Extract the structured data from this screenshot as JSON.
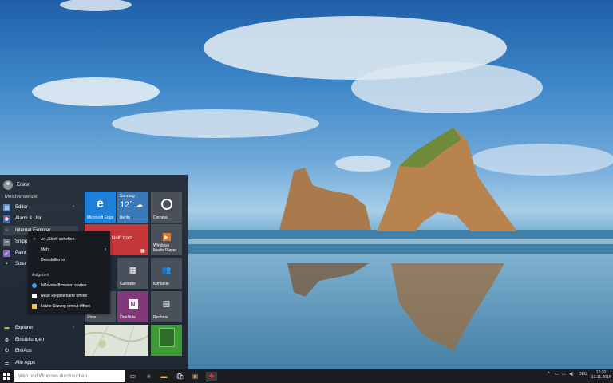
{
  "start_menu": {
    "user_name": "Erster",
    "section_most_used": "Meistverwendet",
    "apps": [
      {
        "label": "Editor",
        "has_submenu": true,
        "icon": "notepad-icon"
      },
      {
        "label": "Alarm & Uhr",
        "has_submenu": false,
        "icon": "alarm-clock-icon"
      },
      {
        "label": "Internet Explorer",
        "has_submenu": false,
        "icon": "internet-explorer-icon"
      },
      {
        "label": "Snipp",
        "has_submenu": false,
        "icon": "snipping-tool-icon"
      },
      {
        "label": "Paint",
        "has_submenu": false,
        "icon": "paint-icon"
      },
      {
        "label": "Sizer",
        "has_submenu": false,
        "icon": "plus-icon"
      }
    ],
    "bottom": [
      {
        "label": "Explorer",
        "has_submenu": true,
        "icon": "folder-icon"
      },
      {
        "label": "Einstellungen",
        "has_submenu": false,
        "icon": "gear-icon"
      },
      {
        "label": "Ein/Aus",
        "has_submenu": false,
        "icon": "power-icon"
      },
      {
        "label": "Alle Apps",
        "has_submenu": false,
        "icon": "list-icon"
      }
    ],
    "tiles": {
      "edge": "Microsoft Edge",
      "weather_day": "Sonntag",
      "weather_temp": "12°",
      "weather_city": "Berlin",
      "cortana": "Cortana",
      "news_text": "Null\" trotz",
      "wmp": "Windows Media Player",
      "calendar": "Kalender",
      "contacts": "Kontakte",
      "xbox_label": "Xbox",
      "onenote": "OneNote",
      "calculator": "Rechner"
    }
  },
  "context_menu": {
    "items": [
      {
        "label": "An „Start\" anheften",
        "icon": "pin-icon"
      },
      {
        "label": "Mehr",
        "icon": "",
        "has_submenu": true
      },
      {
        "label": "Deinstallieren",
        "icon": ""
      }
    ],
    "tasks_header": "Aufgaben",
    "tasks": [
      {
        "label": "InPrivate-Browsen starten",
        "icon": "inprivate-icon"
      },
      {
        "label": "Neue Registerkarte öffnen",
        "icon": "new-tab-icon"
      },
      {
        "label": "Letzte Sitzung erneut öffnen",
        "icon": "folder-icon"
      }
    ]
  },
  "taskbar": {
    "search_placeholder": "Web und Windows durchsuchen",
    "language": "DEU",
    "time": "12:30",
    "date": "13.11.2015"
  },
  "colors": {
    "accent_blue": "#1e7fd7",
    "tile_gray": "#4a5059",
    "red": "#d9383e",
    "purple": "#80397b",
    "green": "#3f9c35"
  }
}
